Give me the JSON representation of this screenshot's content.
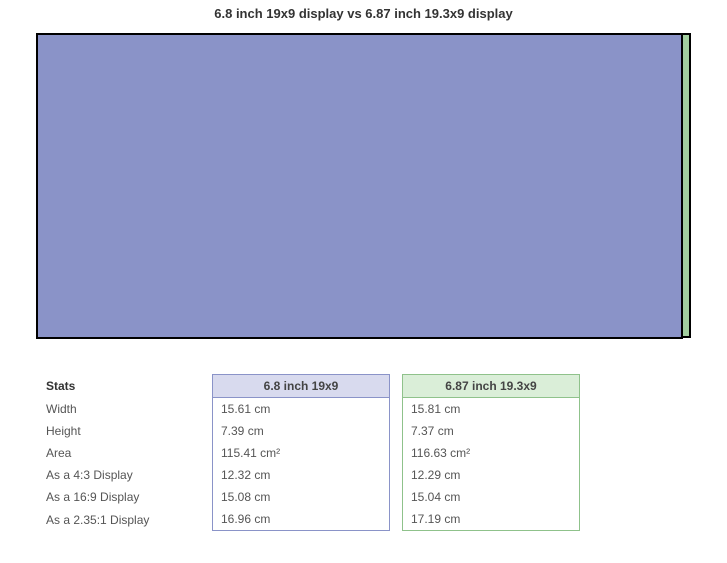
{
  "title": "6.8 inch 19x9 display vs 6.87 inch 19.3x9 display",
  "displayA": {
    "label": "6.8 inch 19x9",
    "color": "#8a93c8"
  },
  "displayB": {
    "label": "6.87 inch 19.3x9",
    "color": "#a2cf9f"
  },
  "rows": {
    "header": "Stats",
    "width": {
      "label": "Width",
      "a": "15.61 cm",
      "b": "15.81 cm"
    },
    "height": {
      "label": "Height",
      "a": "7.39 cm",
      "b": "7.37 cm"
    },
    "area": {
      "label": "Area",
      "a": "115.41 cm²",
      "b": "116.63 cm²"
    },
    "as43": {
      "label": "As a 4:3 Display",
      "a": "12.32 cm",
      "b": "12.29 cm"
    },
    "as169": {
      "label": "As a 16:9 Display",
      "a": "15.08 cm",
      "b": "15.04 cm"
    },
    "as235": {
      "label": "As a 2.35:1 Display",
      "a": "16.96 cm",
      "b": "17.19 cm"
    }
  },
  "chart_data": {
    "type": "table",
    "title": "6.8 inch 19x9 display vs 6.87 inch 19.3x9 display",
    "series": [
      {
        "name": "6.8 inch 19x9",
        "width_cm": 15.61,
        "height_cm": 7.39,
        "area_cm2": 115.41,
        "as_4_3_cm": 12.32,
        "as_16_9_cm": 15.08,
        "as_2_35_1_cm": 16.96,
        "aspect": [
          19,
          9
        ],
        "diag_in": 6.8
      },
      {
        "name": "6.87 inch 19.3x9",
        "width_cm": 15.81,
        "height_cm": 7.37,
        "area_cm2": 116.63,
        "as_4_3_cm": 12.29,
        "as_16_9_cm": 15.04,
        "as_2_35_1_cm": 17.19,
        "aspect": [
          19.3,
          9
        ],
        "diag_in": 6.87
      }
    ],
    "metrics": [
      "Width",
      "Height",
      "Area",
      "As a 4:3 Display",
      "As a 16:9 Display",
      "As a 2.35:1 Display"
    ]
  }
}
